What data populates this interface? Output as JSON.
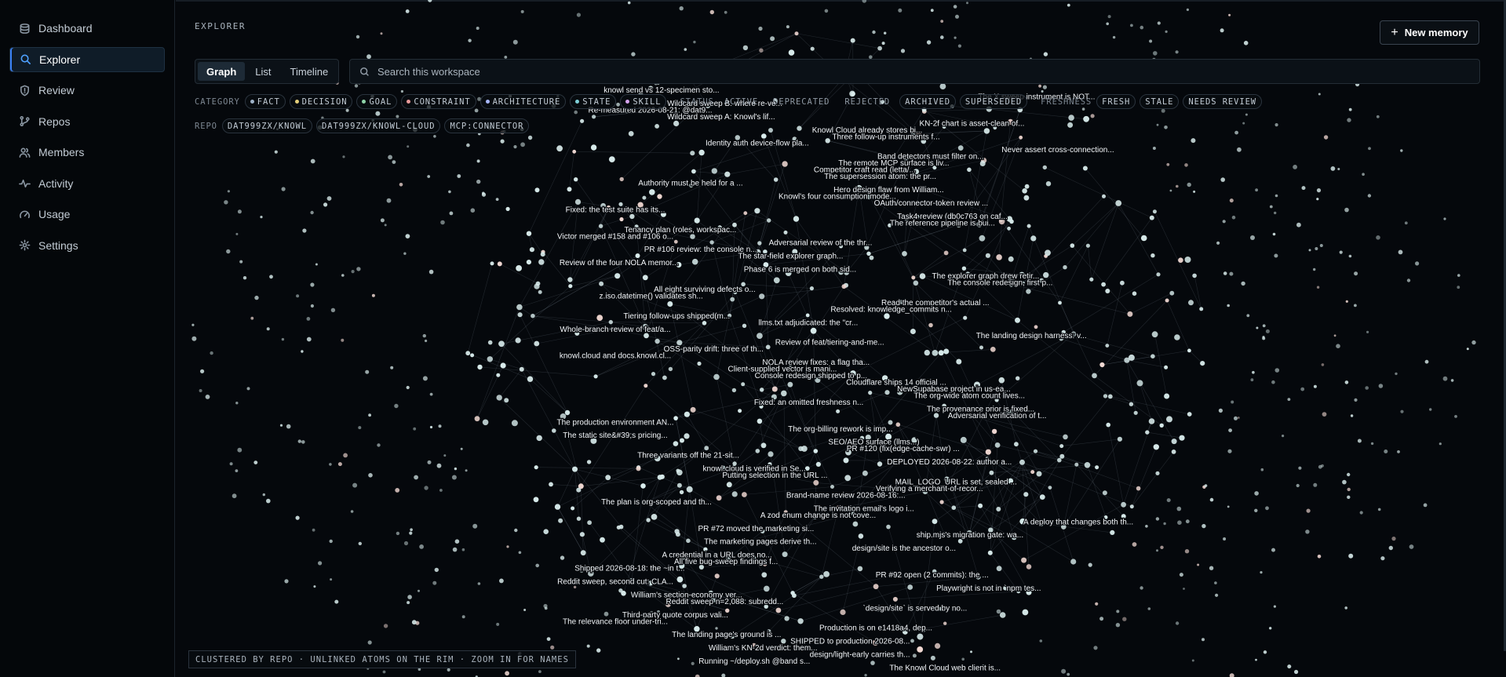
{
  "sidebar": {
    "items": [
      {
        "label": "Dashboard",
        "icon": "dashboard-icon",
        "active": false
      },
      {
        "label": "Explorer",
        "icon": "search-icon",
        "active": true
      },
      {
        "label": "Review",
        "icon": "shield-icon",
        "active": false
      },
      {
        "label": "Repos",
        "icon": "branch-icon",
        "active": false
      },
      {
        "label": "Members",
        "icon": "users-icon",
        "active": false
      },
      {
        "label": "Activity",
        "icon": "activity-icon",
        "active": false
      },
      {
        "label": "Usage",
        "icon": "gauge-icon",
        "active": false
      },
      {
        "label": "Settings",
        "icon": "gear-icon",
        "active": false
      }
    ]
  },
  "header": {
    "section_title": "EXPLORER",
    "new_button_label": "New memory"
  },
  "view_tabs": [
    "Graph",
    "List",
    "Timeline"
  ],
  "active_view": "Graph",
  "search": {
    "placeholder": "Search this workspace",
    "value": ""
  },
  "filters": {
    "category_label": "CATEGORY",
    "categories": [
      {
        "label": "FACT",
        "color": "#9fb3c8"
      },
      {
        "label": "DECISION",
        "color": "#e4cf7a"
      },
      {
        "label": "GOAL",
        "color": "#8fd3a8"
      },
      {
        "label": "CONSTRAINT",
        "color": "#e89a9a"
      },
      {
        "label": "ARCHITECTURE",
        "color": "#a9b8ff"
      },
      {
        "label": "STATE",
        "color": "#7fd0d8"
      },
      {
        "label": "SKILL",
        "color": "#d6a4f0"
      }
    ],
    "status_label": "STATUS",
    "statuses": [
      "ACTIVE",
      "DEPRECATED",
      "REJECTED",
      "ARCHIVED",
      "SUPERSEDED"
    ],
    "freshness_label": "FRESHNESS",
    "freshness": [
      "FRESH",
      "STALE",
      "NEEDS REVIEW"
    ],
    "repo_label": "REPO",
    "repos": [
      "DAT999ZX/KNOWL",
      "DAT999ZX/KNOWL-CLOUD",
      "MCP:CONNECTOR"
    ]
  },
  "footer_note": "CLUSTERED BY REPO · UNLINKED ATOMS ON THE RIM · ZOOM IN FOR NAMES",
  "graph": {
    "colors": {
      "background": "#05080c",
      "node": "#d9ecec",
      "node_warm": "#f0d8d2",
      "edge": "#8a96a3"
    },
    "labels": [
      "knowl send vs 12-specimen sto...",
      "The X sweep instrument is NOT...",
      "Wildcard sweep B: where re-ve...",
      "Re-measured 2026-08-21: @dat9...",
      "Wildcard sweep A: Knowl's lif...",
      "KN-2f chart is asset-clean of...",
      "Knowl Cloud already stores bi...",
      "Three follow-up instruments f...",
      "Identity auth device-flow pla...",
      "Never assert cross-connection...",
      "Band detectors must filter on...",
      "The remote MCP surface is liv...",
      "Competitor craft read (letta/...",
      "The supersession atom: the pr...",
      "Authority must be held for a ...",
      "Hero design flaw from William...",
      "Knowl's four consumption mode...",
      "OAuth/connector-token review ...",
      "Fixed: the test suite has its...",
      "Task4 review (db0c763 on caf...",
      "The reference pipeline is bui...",
      "Tenancy plan (roles, workspac...",
      "Victor merged #158 and #106 o...",
      "Adversarial review of the thr...",
      "PR #106 review: the console n...",
      "The star-field explorer graph...",
      "Review of the four NOLA memor...",
      "Phase 6 is merged on both sid...",
      "The explorer graph drew retir...",
      "The console redesign, first p...",
      "All eight surviving defects o...",
      "z.iso.datetime() validates sh...",
      "Read the competitor's actual ...",
      "Resolved: knowledge_commits n...",
      "Tiering follow-ups shipped(m...",
      "llms.txt adjudicated: the \"cr...",
      "Whole-branch review of feat/a...",
      "The landing design harness: v...",
      "Review of feat/tiering-and-me...",
      "OSS-parity drift: three of th...",
      "knowl.cloud and docs.knowl.cl...",
      "NOLA review fixes: a flag tha...",
      "Client-supplied vector is mani...",
      "Console redesign shipped to p...",
      "Cloudflare ships 14 official ...",
      "NewSupabase project in us-ea...",
      "The org-wide atom count lives...",
      "Fixed: an omitted freshness n...",
      "The provenance prior is fixed...",
      "Adversarial verification of t...",
      "The production environment AN...",
      "The org-billing rework is imp...",
      "The static site&#39;s pricing...",
      "SEO/AEO surface (llms...)",
      "PR #120 (fix(edge-cache-swr) ...",
      "Three variants off the 21-sit...",
      "DEPLOYED 2026-08-22: author a...",
      "knowl.cloud is verified in Se...",
      "Putting selection in the URL ...",
      "MAIL_LOGO_URL is set, sealed ...",
      "Verifying a merchant-of-recor...",
      "Brand-name review 2026-08-16:...",
      "The plan is org-scoped and th...",
      "The invitation email's logo i...",
      "A zod enum change is not cove...",
      "A deploy that changes both th...",
      "PR #72 moved the marketing si...",
      "ship.mjs's migration gate: wa...",
      "The marketing pages derive th...",
      "design/site is the ancestor o...",
      "A credential in a URL does no...",
      "All five bug-sweep findings f...",
      "Shipped 2026-08-18: the ~in t...",
      "PR #92 open (2 commits): the ...",
      "Reddit sweep, second cut: CLA...",
      "Playwright is not in `npm tes...",
      "William's section-economy ver...",
      "Reddit sweep n=2,088: subredd...",
      "`design/site` is served by no...",
      "Third-party quote corpus vali...",
      "The relevance floor under-tri...",
      "Production is on e1418a4, dep...",
      "The landing page's ground is ...",
      "SHIPPED to production 2026-08...",
      "William's KN-2d verdict: them...",
      "design/light-early carries th...",
      "Running ~/deploy.sh @band s...",
      "The Knowl Cloud web client is..."
    ]
  }
}
